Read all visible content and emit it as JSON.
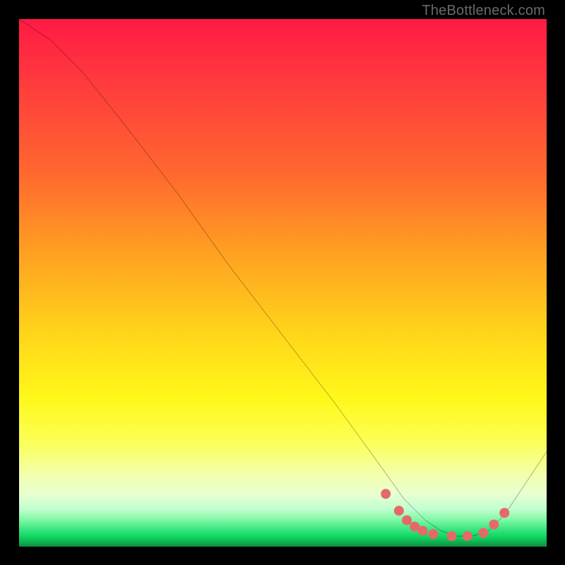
{
  "watermark": "TheBottleneck.com",
  "chart_data": {
    "type": "line",
    "title": "",
    "xlabel": "",
    "ylabel": "",
    "xlim": [
      0,
      100
    ],
    "ylim": [
      0,
      100
    ],
    "grid": false,
    "series": [
      {
        "name": "curve",
        "x": [
          0,
          6,
          12,
          20,
          30,
          40,
          50,
          60,
          68,
          73,
          77,
          80,
          83,
          86,
          89,
          92,
          96,
          100
        ],
        "y": [
          100,
          96,
          90,
          80,
          67,
          53,
          40,
          27,
          16,
          9,
          5,
          3,
          2,
          2,
          3,
          6,
          12,
          18
        ]
      }
    ],
    "markers": {
      "name": "highlight-dots",
      "x": [
        69.5,
        72,
        73.5,
        75,
        76.5,
        78.5,
        82,
        85,
        88,
        90,
        92
      ],
      "y": [
        10,
        6.8,
        5,
        3.8,
        3,
        2.4,
        2,
        2,
        2.6,
        4.2,
        6.4
      ],
      "color": "#e46a6a",
      "size": 7
    },
    "background": {
      "type": "vertical-gradient",
      "stops": [
        {
          "pos": 0.0,
          "color": "#ff1a45"
        },
        {
          "pos": 0.3,
          "color": "#ff6a2e"
        },
        {
          "pos": 0.6,
          "color": "#ffd61a"
        },
        {
          "pos": 0.8,
          "color": "#fcff55"
        },
        {
          "pos": 0.93,
          "color": "#bfffcf"
        },
        {
          "pos": 0.98,
          "color": "#10d35f"
        },
        {
          "pos": 1.0,
          "color": "#0d8d42"
        }
      ]
    }
  }
}
